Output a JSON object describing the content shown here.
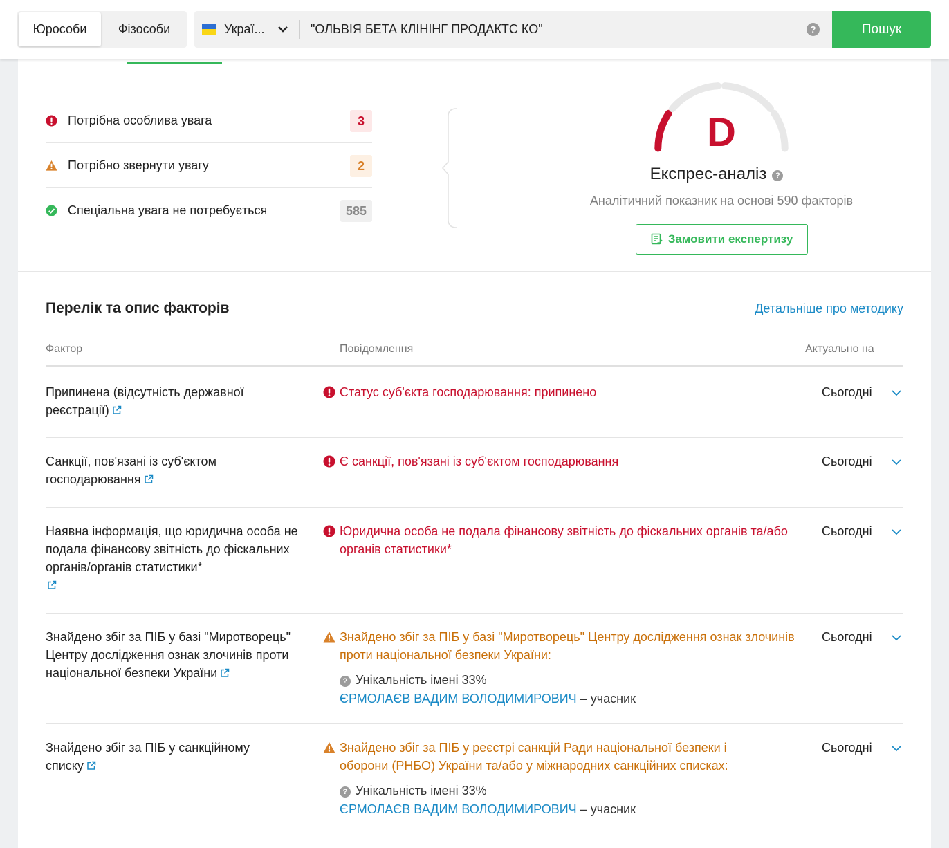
{
  "header": {
    "tabs": [
      "Юрособи",
      "Фізособи"
    ],
    "country": "Украї...",
    "query": "\"ОЛЬВІЯ БЕТА КЛІНІНГ ПРОДАКТС КО\"",
    "help": "?",
    "search_label": "Пошук"
  },
  "summary": {
    "items": [
      {
        "label": "Потрібна особлива увага",
        "count": "3",
        "status": "error"
      },
      {
        "label": "Потрібно звернути увагу",
        "count": "2",
        "status": "warning"
      },
      {
        "label": "Спеціальна увага не потребується",
        "count": "585",
        "status": "ok"
      }
    ]
  },
  "analysis": {
    "grade": "D",
    "title": "Експрес-аналіз",
    "help": "?",
    "subtitle": "Аналітичний показник на основі 590 факторів",
    "order_label": "Замовити експертизу",
    "colors": {
      "grade": "#c8102e",
      "gauge_track": "#e8e8e8"
    }
  },
  "factors": {
    "title": "Перелік та опис факторів",
    "method_link": "Детальніше про методику",
    "columns": {
      "factor": "Фактор",
      "message": "Повідомлення",
      "date": "Актуально на"
    },
    "rows": [
      {
        "factor": "Припинена (відсутність державної реєстрації)",
        "severity": "error",
        "message": "Статус суб'єкта господарювання: припинено",
        "date": "Сьогодні"
      },
      {
        "factor": "Санкції, пов'язані із суб'єктом господарювання",
        "severity": "error",
        "message": "Є санкції, пов'язані із суб'єктом господарювання",
        "date": "Сьогодні"
      },
      {
        "factor": "Наявна інформація, що юридична особа не подала фінансову звітність до фіскальних органів/органів статистики*",
        "severity": "error",
        "message": "Юридична особа не подала фінансову звітність до фіскальних органів та/або органів статистики*",
        "date": "Сьогодні"
      },
      {
        "factor": "Знайдено збіг за ПІБ у базі \"Миротворець\" Центру дослідження ознак злочинів проти національної безпеки України",
        "severity": "warning",
        "message": "Знайдено збіг за ПІБ у базі \"Миротворець\" Центру дослідження ознак злочинів проти національної безпеки України:",
        "uniqueness": "Унікальність імені 33%",
        "person": "ЄРМОЛАЄВ ВАДИМ ВОЛОДИМИРОВИЧ",
        "role": "– учасник",
        "date": "Сьогодні"
      },
      {
        "factor": "Знайдено збіг за ПІБ у санкційному списку",
        "severity": "warning",
        "message": "Знайдено збіг за ПІБ у реєстрі санкцій Ради національної безпеки і оборони (РНБО) України та/або у міжнародних санкційних списках:",
        "uniqueness": "Унікальність імені 33%",
        "person": "ЄРМОЛАЄВ ВАДИМ ВОЛОДИМИРОВИЧ",
        "role": "– учасник",
        "date": "Сьогодні"
      }
    ]
  },
  "colors": {
    "accent": "#35b85a",
    "link": "#1a8ac6",
    "error": "#c8102e",
    "warning": "#c9700a"
  }
}
